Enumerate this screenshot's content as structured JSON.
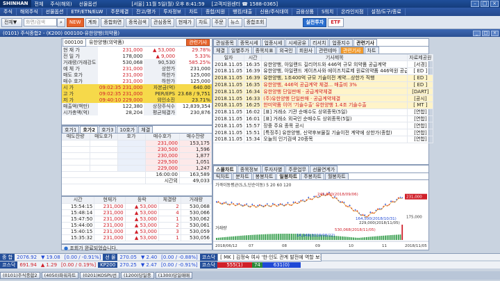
{
  "titlebar": {
    "logo": "SHINHAN",
    "items": [
      "전체",
      "주식(해외)",
      "선물옵션",
      "[서울] 11월 5일(월) 오후 8:41:59",
      "[고객지원센터 ☎ 1588-0365]"
    ]
  },
  "menu": [
    "주식",
    "해외주식",
    "선물옵션",
    "ETF/ETN/ELW",
    "주문체결",
    "잔고/평가",
    "투자정보",
    "차트",
    "종합/지원",
    "뱅킹/대출",
    "신용/주식대여",
    "금융상품",
    "S워치",
    "온라인지점",
    "설정/도구/종료"
  ],
  "toolbar": {
    "search_placeholder": "화면/검색",
    "buttons": [
      "NEW",
      "계좌",
      "종합화면",
      "종목검색",
      "관심종목",
      "현재가",
      "차트",
      "주문",
      "뉴스",
      "종합조회"
    ],
    "realtime": "실전투자",
    "etf": "ETF"
  },
  "window": {
    "title": "(0101) 주식종합2 - (K200) 000100-유한양행(의약품)"
  },
  "stock": {
    "code": "000100",
    "name": "유한양행(의약품)",
    "tag": "관련기사",
    "quote": [
      {
        "l": "현 재 가",
        "v": "231,000",
        "c": "▲ 53,000",
        "r": "29.78%"
      },
      {
        "l": "전 일 가",
        "v": "178,000",
        "c": "▲ 9,000",
        "r": "5.33%"
      },
      {
        "l": "거래량/거래강도",
        "v": "530,068",
        "c": "90,530",
        "r": "585.25%"
      },
      {
        "l": "예 체 가",
        "v": "231,000",
        "c": "상한가",
        "r": "231,000"
      },
      {
        "l": "매도 호가",
        "v": "231,000",
        "c": "하한가",
        "r": "125,000"
      },
      {
        "l": "매수 호가",
        "v": "231,000",
        "c": "하한가",
        "r": "125,000"
      },
      {
        "l": "시 가",
        "v": "09:02:35 231,000",
        "c": "자본금(억)",
        "r": "640.00"
      },
      {
        "l": "고 가",
        "v": "09:02:35 231,000",
        "c": "PER/EPS",
        "r": "23.68 / 9,751"
      },
      {
        "l": "저 가",
        "v": "09:40:10 229,000",
        "c": "외인소진",
        "r": "23.71%"
      },
      {
        "l": "매출액(백만)",
        "v": "122,380",
        "c": "상장주식수",
        "r": "12,839,354"
      },
      {
        "l": "시가총액(억)",
        "v": "28,204",
        "c": "평균체결가",
        "r": "230,876"
      }
    ],
    "obtabs": [
      "호가1",
      "호가2",
      "호가3",
      "10호가",
      "체결"
    ],
    "obhead": [
      "매도잔량",
      "매도호가",
      "호가",
      "매수호가",
      "매수잔량"
    ],
    "ob": [
      {
        "p": "231,000",
        "q": "153,175"
      },
      {
        "p": "230,500",
        "q": "1,596"
      },
      {
        "p": "230,000",
        "q": "1,877"
      },
      {
        "p": "229,500",
        "q": "1,051"
      },
      {
        "p": "229,000",
        "q": "1,247"
      }
    ],
    "obfoot": {
      "time": "16:00:00",
      "total": "163,589",
      "label": "시간외",
      "after": "49,033"
    },
    "tradehead": [
      "시간",
      "현재가",
      "등락",
      "체결량",
      "거래량"
    ],
    "trades": [
      {
        "t": "15:54:15",
        "p": "231,000",
        "c": "▲ 53,000",
        "q": "2",
        "v": "530,068"
      },
      {
        "t": "15:48:14",
        "p": "231,000",
        "c": "▲ 53,000",
        "q": "4",
        "v": "530,066"
      },
      {
        "t": "15:47:50",
        "p": "231,000",
        "c": "▲ 53,000",
        "q": "1",
        "v": "530,062"
      },
      {
        "t": "15:44:00",
        "p": "231,000",
        "c": "▲ 53,000",
        "q": "2",
        "v": "530,061"
      },
      {
        "t": "15:40:15",
        "p": "231,000",
        "c": "▲ 53,000",
        "q": "3",
        "v": "530,059"
      },
      {
        "t": "15:35:32",
        "p": "231,000",
        "c": "▲ 53,000",
        "q": "1",
        "v": "530,056"
      }
    ],
    "status": "조회가 완료되었습니다."
  },
  "news": {
    "tabs": [
      "관심종목",
      "종목시세",
      "업종시세",
      "시세공유",
      "리서치",
      "업종지수",
      "관련기사"
    ],
    "subtabs": [
      "체결",
      "일별주가",
      "종목지표",
      "외국인",
      "회원사",
      "관련테마",
      "관련기사",
      "차트"
    ],
    "head": [
      "일자",
      "시간",
      "기사제목",
      "자료제공원"
    ],
    "rows": [
      {
        "d": "2018.11.05",
        "t": "16:35",
        "h": "유한양행, 아일랜드 길리어드와 446억 규모 의약품 공급계약",
        "s": "[서경]"
      },
      {
        "d": "2018.11.05",
        "t": "16:39",
        "h": "유한양행, 아일랜드 게이츠사와 에이즈치료제 원료의약품 446억원 공급계약",
        "s": "[ ED ]"
      },
      {
        "d": "2018.11.05",
        "t": "16:39",
        "h": "유한양행, 1조400억 규모 기술이전 계약...상한가 직행",
        "s": "[ ED ]"
      },
      {
        "d": "2018.11.05",
        "t": "16:35",
        "h": "유한양행, 446억 공급계약 체결... 매출비 3%",
        "s": "[ ED ]"
      },
      {
        "d": "2018.11.05",
        "t": "16:34",
        "h": "유한양행 단일판매ㆍ공급계약체결",
        "s": "[DART]"
      },
      {
        "d": "2018.11.05",
        "t": "16:33",
        "h": "(주)유한양행 단일판매ㆍ공급계약체결",
        "s": "[공시]"
      },
      {
        "d": "2018.11.05",
        "t": "16:25",
        "h": "한미약품 이어 '기술수출' 유한양행 1.4조 기술수출",
        "s": "[ MT ]"
      },
      {
        "d": "2018.11.05",
        "t": "16:02",
        "h": "[표] 거래소 기관 순매수도 상위종목(5일)",
        "s": "[연합]"
      },
      {
        "d": "2018.11.05",
        "t": "16:01",
        "h": "[표] 거래소 외국인 순매수도 상위종목(5일)",
        "s": "[연합]"
      },
      {
        "d": "2018.11.05",
        "t": "15:57",
        "h": "장중 주요 종목 공시",
        "s": "[연합]"
      },
      {
        "d": "2018.11.05",
        "t": "15:51",
        "h": "[특징주] 유한양행, 신약후보물질 기술이전 계약에 상한가(종합)",
        "s": "[연합]"
      },
      {
        "d": "2018.11.05",
        "t": "15:34",
        "h": "오늘의 인기검색 20종목",
        "s": "[연합]"
      }
    ]
  },
  "chart": {
    "tabs": [
      "스몰차트",
      "종목정보",
      "투자자별",
      "주문업무",
      "선물연계가"
    ],
    "sub": [
      "틱차트",
      "분차트",
      "봉봉차트",
      "일봉차트",
      "주봉차트",
      "월봉차트"
    ],
    "legend": "가격이동평균(5,5,단순이동) 5 20 60 120",
    "hi_label": "245,000(2018/09/06)",
    "lo_label": "164,500(2018/10/31)",
    "cur_label": "229,000(2018/11/05)",
    "vol_label": "거래량",
    "vlow": "14,148(2018/08/22)",
    "vhi": "530,068(2018/11/05)",
    "xticks": [
      "2018/06/12",
      "07",
      "08",
      "09",
      "10",
      "11"
    ],
    "xend": "2018/11/05",
    "px": "231,000",
    "pr": "175,000",
    "chart_data": {
      "type": "line",
      "x": [
        "06/12",
        "07",
        "08",
        "09",
        "10",
        "11"
      ],
      "values": [
        215000,
        205000,
        210000,
        240000,
        175000,
        231000
      ]
    }
  },
  "bottom": {
    "r1": [
      {
        "k": "종 합",
        "v": "2076.92",
        "c": "▼ 19.08",
        "p": "[0.00 / -0.91%]"
      },
      {
        "k": "선 물",
        "v": "270.05",
        "c": "▼ 2.40",
        "p": "[0.00 / -0.88%]"
      },
      {
        "k": "코스닥",
        "v": "",
        "c": "",
        "p": "",
        "m": "[ MK ] 김정숙 여사 '한·인도 관계 발전에 역할 보겠다'"
      }
    ],
    "r2": [
      {
        "k": "코스닥",
        "v": "691.94",
        "c": "▲ 1.29",
        "p": "[0.00 / 0.19%]"
      },
      {
        "k": "KP200",
        "v": "270.25",
        "c": "▼ 2.47",
        "p": "[0.00 / -0.91%]"
      }
    ],
    "kq": {
      "u": "555(1)",
      "s": "74",
      "d": "631(0)"
    },
    "tasks": [
      "(0101)주식종합2",
      "(4050)파워차트",
      "(0201)KOSPI/선",
      "(1200)당일종",
      "(1300)당일매매"
    ]
  }
}
